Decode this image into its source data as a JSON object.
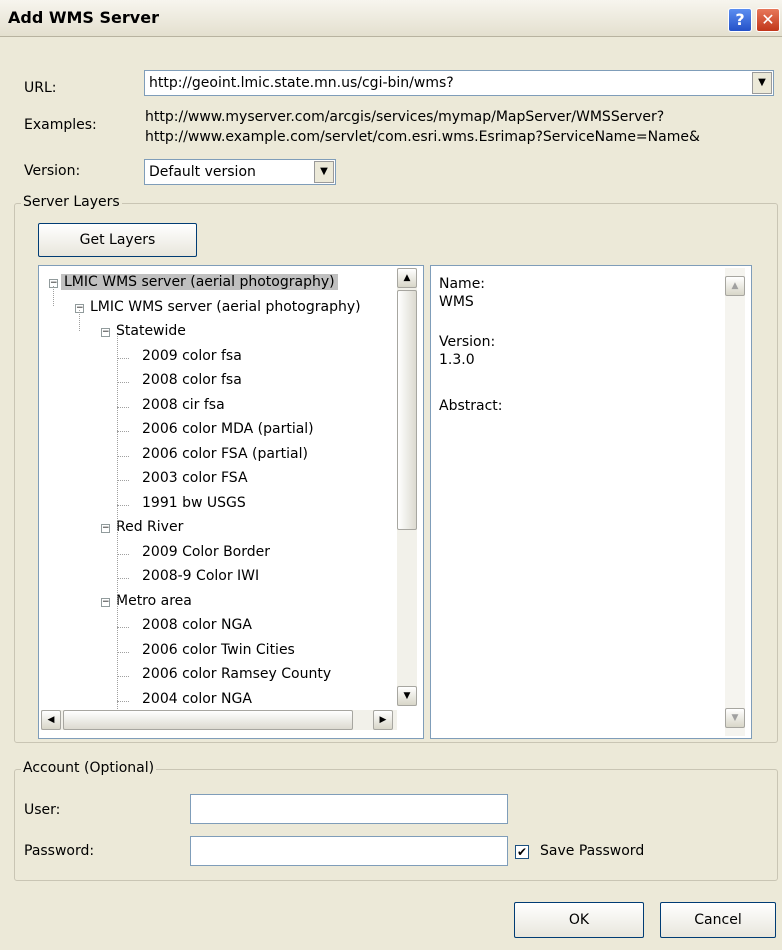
{
  "window": {
    "title": "Add WMS Server",
    "help_glyph": "?",
    "close_glyph": "✕"
  },
  "url": {
    "label": "URL:",
    "value": "http://geoint.lmic.state.mn.us/cgi-bin/wms?"
  },
  "examples": {
    "label": "Examples:",
    "line1": "http://www.myserver.com/arcgis/services/mymap/MapServer/WMSServer?",
    "line2": "http://www.example.com/servlet/com.esri.wms.Esrimap?ServiceName=Name&"
  },
  "version": {
    "label": "Version:",
    "value": "Default version"
  },
  "server_layers": {
    "legend": "Server Layers",
    "get_layers_label": "Get Layers",
    "tree": [
      {
        "label": "LMIC WMS server (aerial photography)",
        "level": 0,
        "expanded": true,
        "selected": true
      },
      {
        "label": "LMIC WMS server (aerial photography)",
        "level": 1,
        "expanded": true
      },
      {
        "label": "Statewide",
        "level": 2,
        "expanded": true
      },
      {
        "label": "2009 color fsa",
        "level": 3
      },
      {
        "label": "2008 color fsa",
        "level": 3
      },
      {
        "label": "2008 cir fsa",
        "level": 3
      },
      {
        "label": "2006 color MDA (partial)",
        "level": 3
      },
      {
        "label": "2006 color FSA (partial)",
        "level": 3
      },
      {
        "label": "2003 color FSA",
        "level": 3
      },
      {
        "label": "1991 bw USGS",
        "level": 3
      },
      {
        "label": "Red River",
        "level": 2,
        "expanded": true
      },
      {
        "label": "2009 Color Border",
        "level": 3
      },
      {
        "label": "2008-9 Color IWI",
        "level": 3
      },
      {
        "label": "Metro area",
        "level": 2,
        "expanded": true
      },
      {
        "label": "2008 color NGA",
        "level": 3
      },
      {
        "label": "2006 color Twin Cities",
        "level": 3
      },
      {
        "label": "2006 color Ramsey County",
        "level": 3
      },
      {
        "label": "2004 color NGA",
        "level": 3
      }
    ],
    "details": {
      "name_label": "Name:",
      "name_value": "WMS",
      "version_label": "Version:",
      "version_value": "1.3.0",
      "abstract_label": "Abstract:"
    }
  },
  "account": {
    "legend": "Account (Optional)",
    "user_label": "User:",
    "user_value": "",
    "password_label": "Password:",
    "password_value": "",
    "save_password_label": "Save Password",
    "save_password_checked": true
  },
  "buttons": {
    "ok": "OK",
    "cancel": "Cancel"
  },
  "colors": {
    "selection": "#c0c0c0",
    "dialog_bg": "#ece9d8"
  }
}
